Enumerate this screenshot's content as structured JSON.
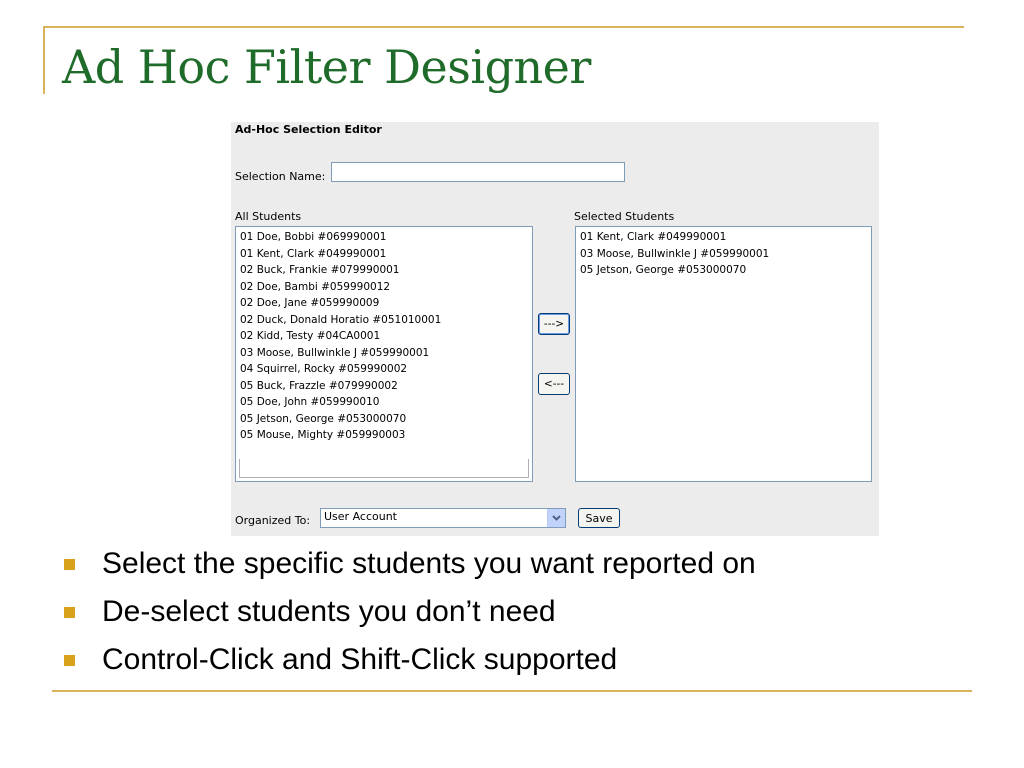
{
  "slide": {
    "title": "Ad Hoc Filter Designer",
    "accent_color": "#D9B45C",
    "title_color": "#1F6B2A",
    "bullet_color": "#D9A21B"
  },
  "editor": {
    "title": "Ad-Hoc Selection Editor",
    "selection_name_label": "Selection Name:",
    "selection_name_value": "",
    "all_students_label": "All Students",
    "selected_students_label": "Selected Students",
    "all_students": [
      "01 Doe, Bobbi  #069990001",
      "01 Kent, Clark  #049990001",
      "02 Buck, Frankie  #079990001",
      "02 Doe, Bambi  #059990012",
      "02 Doe, Jane  #059990009",
      "02 Duck, Donald Horatio #051010001",
      "02 Kidd, Testy  #04CA0001",
      "03 Moose, Bullwinkle J #059990001",
      "04 Squirrel, Rocky  #059990002",
      "05 Buck, Frazzle  #079990002",
      "05 Doe, John  #059990010",
      "05 Jetson, George  #053000070",
      "05 Mouse, Mighty  #059990003"
    ],
    "selected_students": [
      "01 Kent, Clark  #049990001",
      "03 Moose, Bullwinkle J #059990001",
      "05 Jetson, George  #053000070"
    ],
    "add_button": "--->",
    "remove_button": "<---",
    "organized_to_label": "Organized To:",
    "organized_to_value": "User Account",
    "save_button": "Save",
    "dropdown_icon": "chevron-down-icon"
  },
  "bullets": [
    "Select the specific students you want reported on",
    "De-select students you don’t need",
    "Control-Click and Shift-Click supported"
  ]
}
